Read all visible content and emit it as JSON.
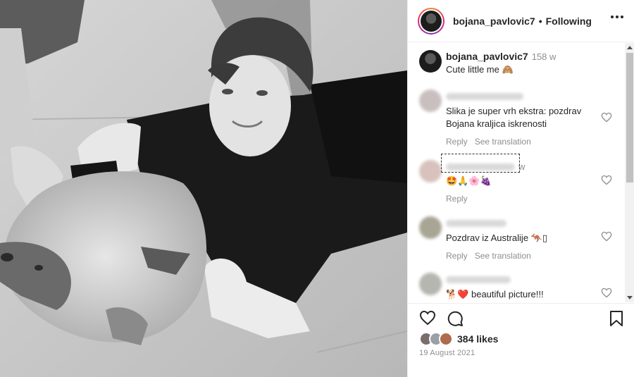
{
  "post": {
    "username": "bojana_pavlovic7",
    "separator": "•",
    "follow_status": "Following",
    "caption": {
      "username": "bojana_pavlovic7",
      "time": "158 w",
      "text": "Cute little me 🙈"
    },
    "comments": [
      {
        "text": "Slika je super vrh ekstra: pozdrav Bojana kraljica iskrenosti",
        "actions": [
          "Reply",
          "See translation"
        ]
      },
      {
        "time_fragment": "w",
        "text": "🤩🙏🌸🍇",
        "actions": [
          "Reply"
        ]
      },
      {
        "text": "Pozdrav iz Australije 🦘▯",
        "actions": [
          "Reply",
          "See translation"
        ]
      },
      {
        "text": "🐕❤️ beautiful picture!!!",
        "actions": []
      }
    ],
    "likes": "384 likes",
    "date": "19 August 2021"
  },
  "icons": [
    "more-options-icon",
    "heart-icon",
    "comment-icon",
    "bookmark-icon",
    "small-heart-icon"
  ],
  "colors": {
    "text": "#262626",
    "secondary": "#8e8e8e",
    "border": "#efefef"
  }
}
